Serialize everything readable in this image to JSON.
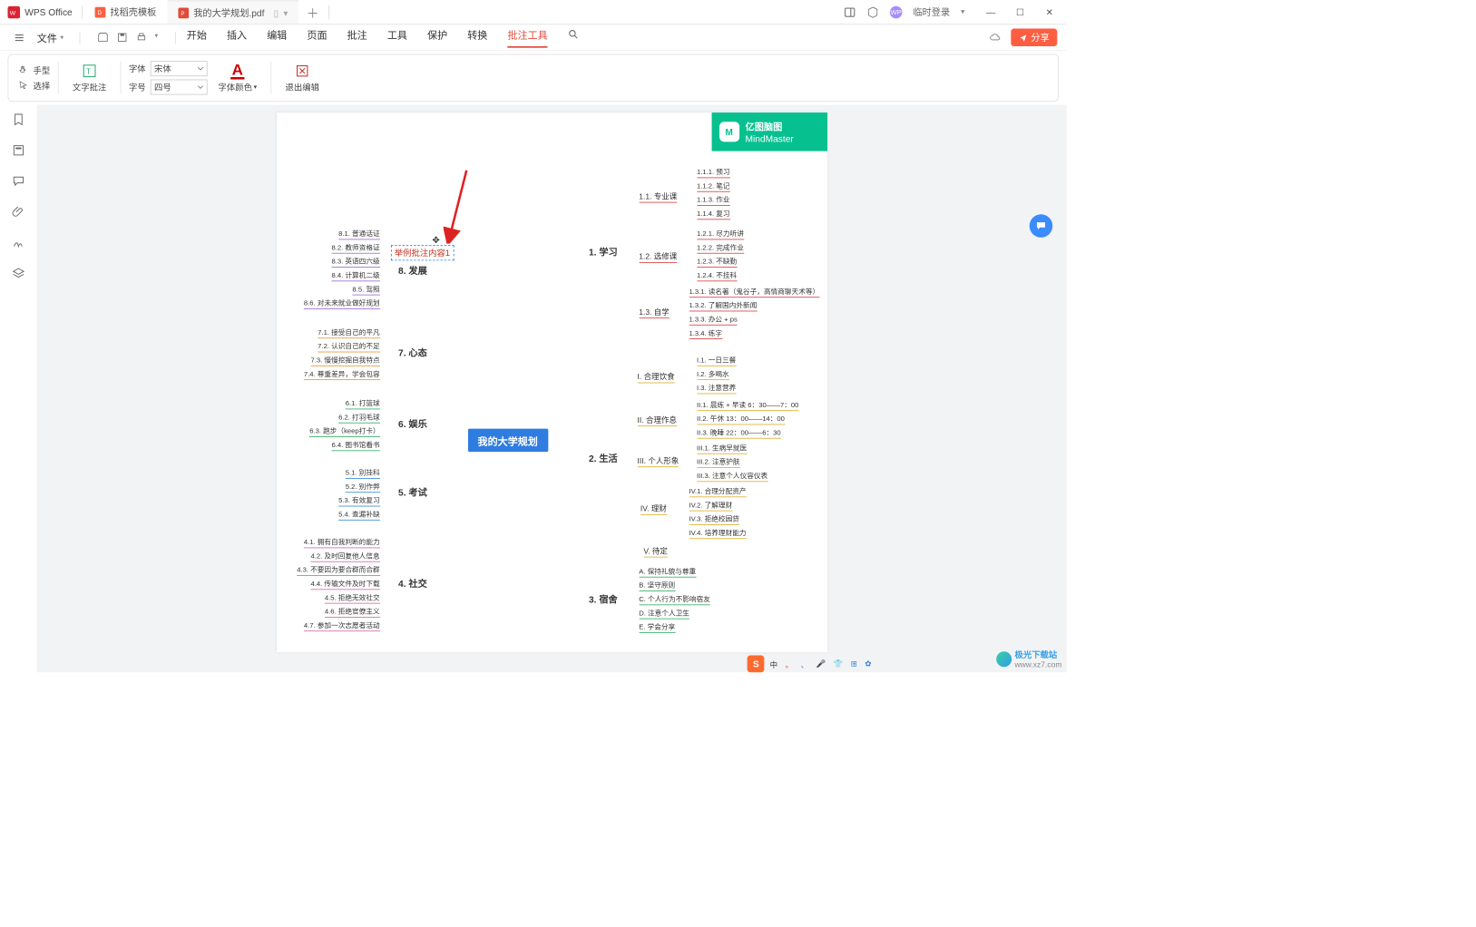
{
  "title_bar": {
    "app": "WPS Office",
    "tab1": "找稻壳模板",
    "tab2": "我的大学规划.pdf",
    "login": "临时登录"
  },
  "menu": {
    "file": "文件",
    "items": [
      "开始",
      "插入",
      "编辑",
      "页面",
      "批注",
      "工具",
      "保护",
      "转换",
      "批注工具"
    ],
    "active_index": 8,
    "share": "分享"
  },
  "ribbon": {
    "hand": "手型",
    "select": "选择",
    "text_annot": "文字批注",
    "font_label": "字体",
    "font_value": "宋体",
    "size_label": "字号",
    "size_value": "四号",
    "font_color": "字体颜色",
    "exit": "退出编辑"
  },
  "brand": {
    "line1": "亿图脑图",
    "line2": "MindMaster"
  },
  "center": "我的大学规划",
  "annotation": "举例批注内容1",
  "left_branches": {
    "b8": {
      "title": "8. 发展",
      "items": [
        "8.1. 普通话证",
        "8.2. 教师资格证",
        "8.3. 英语四六级",
        "8.4. 计算机二级",
        "8.5. 驾照",
        "8.6. 对未来就业做好规划"
      ]
    },
    "b7": {
      "title": "7. 心态",
      "items": [
        "7.1. 接受自己的平凡",
        "7.2. 认识自己的不足",
        "7.3. 慢慢挖掘自我特点",
        "7.4. 尊重差异，学会包容"
      ]
    },
    "b6": {
      "title": "6. 娱乐",
      "items": [
        "6.1. 打篮球",
        "6.2. 打羽毛球",
        "6.3. 跑步（keep打卡）",
        "6.4. 图书馆看书"
      ]
    },
    "b5": {
      "title": "5. 考试",
      "items": [
        "5.1. 别挂科",
        "5.2. 别作弊",
        "5.3. 有效复习",
        "5.4. 查漏补缺"
      ]
    },
    "b4": {
      "title": "4. 社交",
      "items": [
        "4.1. 拥有自我判断的能力",
        "4.2. 及时回复他人信息",
        "4.3. 不要因为要合群而合群",
        "4.4. 传输文件及时下载",
        "4.5. 拒绝无效社交",
        "4.6. 拒绝官僚主义",
        "4.7. 参加一次志愿者活动"
      ]
    }
  },
  "right_branches": {
    "b1": {
      "title": "1. 学习",
      "subs": {
        "s11": {
          "label": "1.1. 专业课",
          "items": [
            "1.1.1. 预习",
            "1.1.2. 笔记",
            "1.1.3. 作业",
            "1.1.4. 复习"
          ]
        },
        "s12": {
          "label": "1.2. 选修课",
          "items": [
            "1.2.1. 尽力听讲",
            "1.2.2. 完成作业",
            "1.2.3. 不缺勤",
            "1.2.4. 不挂科"
          ]
        },
        "s13": {
          "label": "1.3. 自学",
          "items": [
            "1.3.1. 读名著（鬼谷子，高情商聊天术等）",
            "1.3.2. 了解国内外新闻",
            "1.3.3. 办公 + ps",
            "1.3.4. 练字"
          ]
        }
      }
    },
    "b2": {
      "title": "2. 生活",
      "subs": {
        "s21": {
          "label": "I. 合理饮食",
          "items": [
            "I.1. 一日三餐",
            "I.2. 多喝水",
            "I.3. 注意营养"
          ]
        },
        "s22": {
          "label": "II. 合理作息",
          "items": [
            "II.1. 晨练 + 早读 6：30——7：00",
            "II.2. 午休 13：00——14：00",
            "II.3. 晚睡 22：00——6：30"
          ]
        },
        "s23": {
          "label": "III. 个人形象",
          "items": [
            "III.1. 生病早就医",
            "III.2. 注意护肤",
            "III.3. 注意个人仪容仪表"
          ]
        },
        "s24": {
          "label": "IV. 理财",
          "items": [
            "IV.1. 合理分配资产",
            "IV.2. 了解理财",
            "IV.3. 拒绝校园贷",
            "IV.4. 培养理财能力"
          ]
        },
        "s25": {
          "label": "V. 待定",
          "items": []
        }
      }
    },
    "b3": {
      "title": "3. 宿舍",
      "items": [
        "A. 保持礼貌与尊重",
        "B. 坚守原则",
        "C. 个人行为不影响宿友",
        "D. 注意个人卫生",
        "E. 学会分享"
      ]
    }
  },
  "sogou": {
    "chars": [
      "中",
      "。",
      "、",
      "●"
    ]
  },
  "watermark": {
    "text": "极光下载站",
    "url": "www.xz7.com"
  }
}
